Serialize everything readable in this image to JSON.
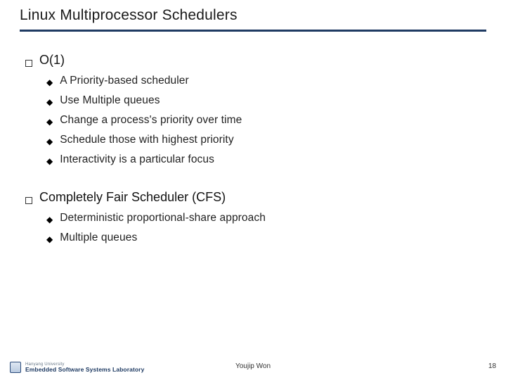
{
  "title": "Linux Multiprocessor Schedulers",
  "sections": [
    {
      "heading": "O(1)",
      "items": [
        "A Priority-based scheduler",
        "Use Multiple queues",
        "Change a process's priority over time",
        "Schedule those with highest priority",
        "Interactivity is a particular focus"
      ]
    },
    {
      "heading": "Completely Fair Scheduler (CFS)",
      "items": [
        "Deterministic proportional-share approach",
        "Multiple queues"
      ]
    }
  ],
  "footer": {
    "logo_line1": "Hanyang University",
    "logo_line2": "Embedded Software Systems Laboratory",
    "author": "Youjip Won",
    "page": "18"
  },
  "colors": {
    "rule": "#1f3b63"
  }
}
